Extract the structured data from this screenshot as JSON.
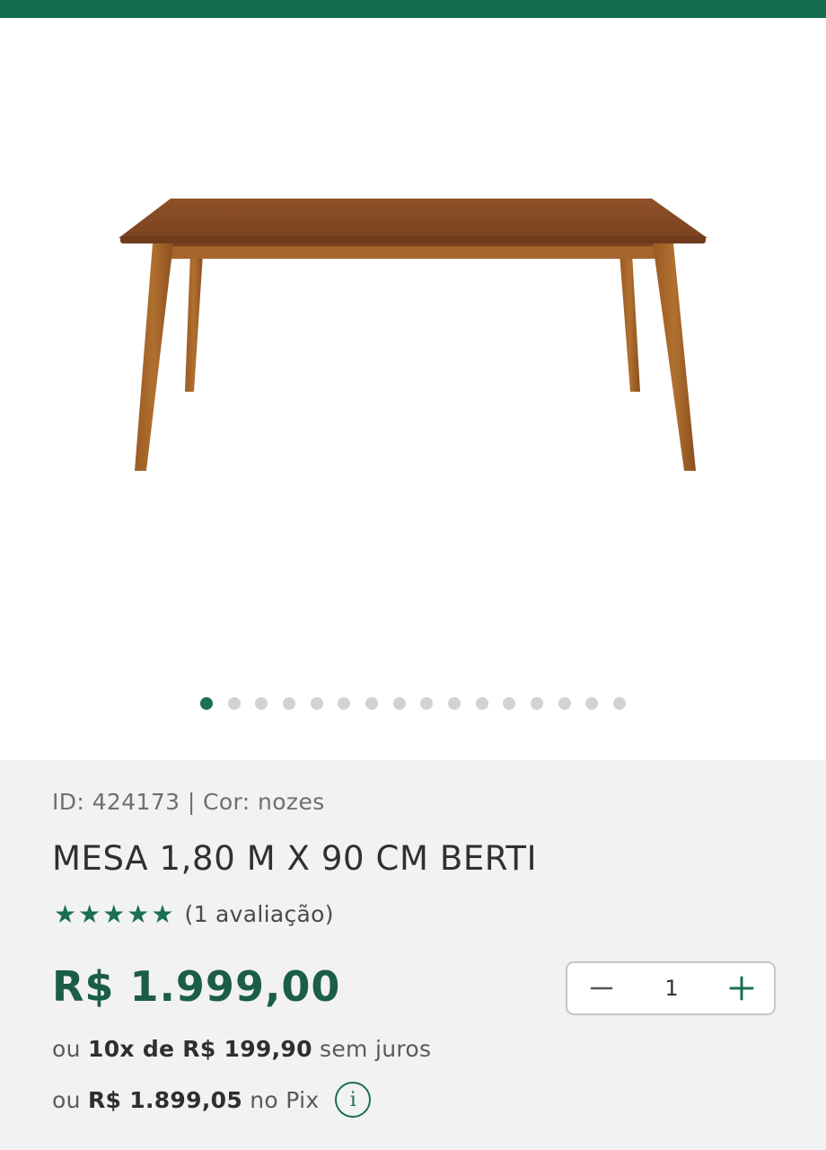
{
  "colors": {
    "brand_green": "#156b4e",
    "price_green": "#1b5e45",
    "wood": "#8a4f24"
  },
  "gallery": {
    "image_subject": "wooden-dining-table",
    "dots_total": 16,
    "active_index": 0
  },
  "product": {
    "id_label": "ID:",
    "id": "424173",
    "color_label": "Cor:",
    "color": "nozes",
    "title": "MESA 1,80 M X 90 CM BERTI",
    "stars": "★★★★★",
    "rating_value": 5,
    "reviews": "(1 avaliação)",
    "price": "R$ 1.999,00"
  },
  "quantity": {
    "value": "1",
    "minus_icon": "minus-icon",
    "plus_icon": "plus-icon"
  },
  "payment": {
    "installments_prefix": "ou",
    "installments_strong": "10x de R$ 199,90",
    "installments_suffix": "sem juros",
    "pix_prefix": "ou",
    "pix_strong": "R$ 1.899,05",
    "pix_suffix": "no Pix",
    "info_glyph": "i"
  }
}
